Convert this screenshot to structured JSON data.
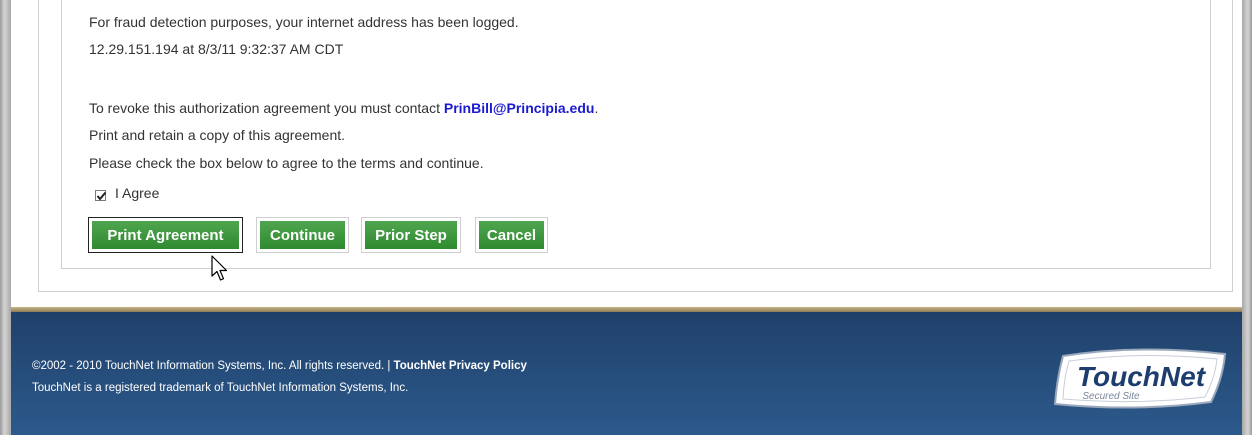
{
  "content": {
    "fraud_line": "For fraud detection purposes, your internet address has been logged.",
    "ip_line": "12.29.151.194 at 8/3/11 9:32:37 AM CDT",
    "revoke_prefix": "To revoke this authorization agreement you must contact ",
    "revoke_email": "PrinBill@Principia.edu",
    "revoke_suffix": ".",
    "print_line": "Print and retain a copy of this agreement.",
    "check_line": "Please check the box below to agree to the terms and continue.",
    "agree_label": "I Agree",
    "agree_checked": true
  },
  "buttons": {
    "print": "Print Agreement",
    "continue": "Continue",
    "prior": "Prior Step",
    "cancel": "Cancel"
  },
  "footer": {
    "copyright": "©2002 - 2010 TouchNet Information Systems, Inc. All rights reserved. | ",
    "privacy_link": "TouchNet Privacy Policy",
    "trademark": "TouchNet is a registered trademark of TouchNet Information Systems, Inc."
  },
  "logo": {
    "brand": "TouchNet",
    "tagline": "Secured Site"
  },
  "colors": {
    "button_green": "#3a953a",
    "footer_blue": "#24497a",
    "link_blue": "#1a1ad0"
  }
}
